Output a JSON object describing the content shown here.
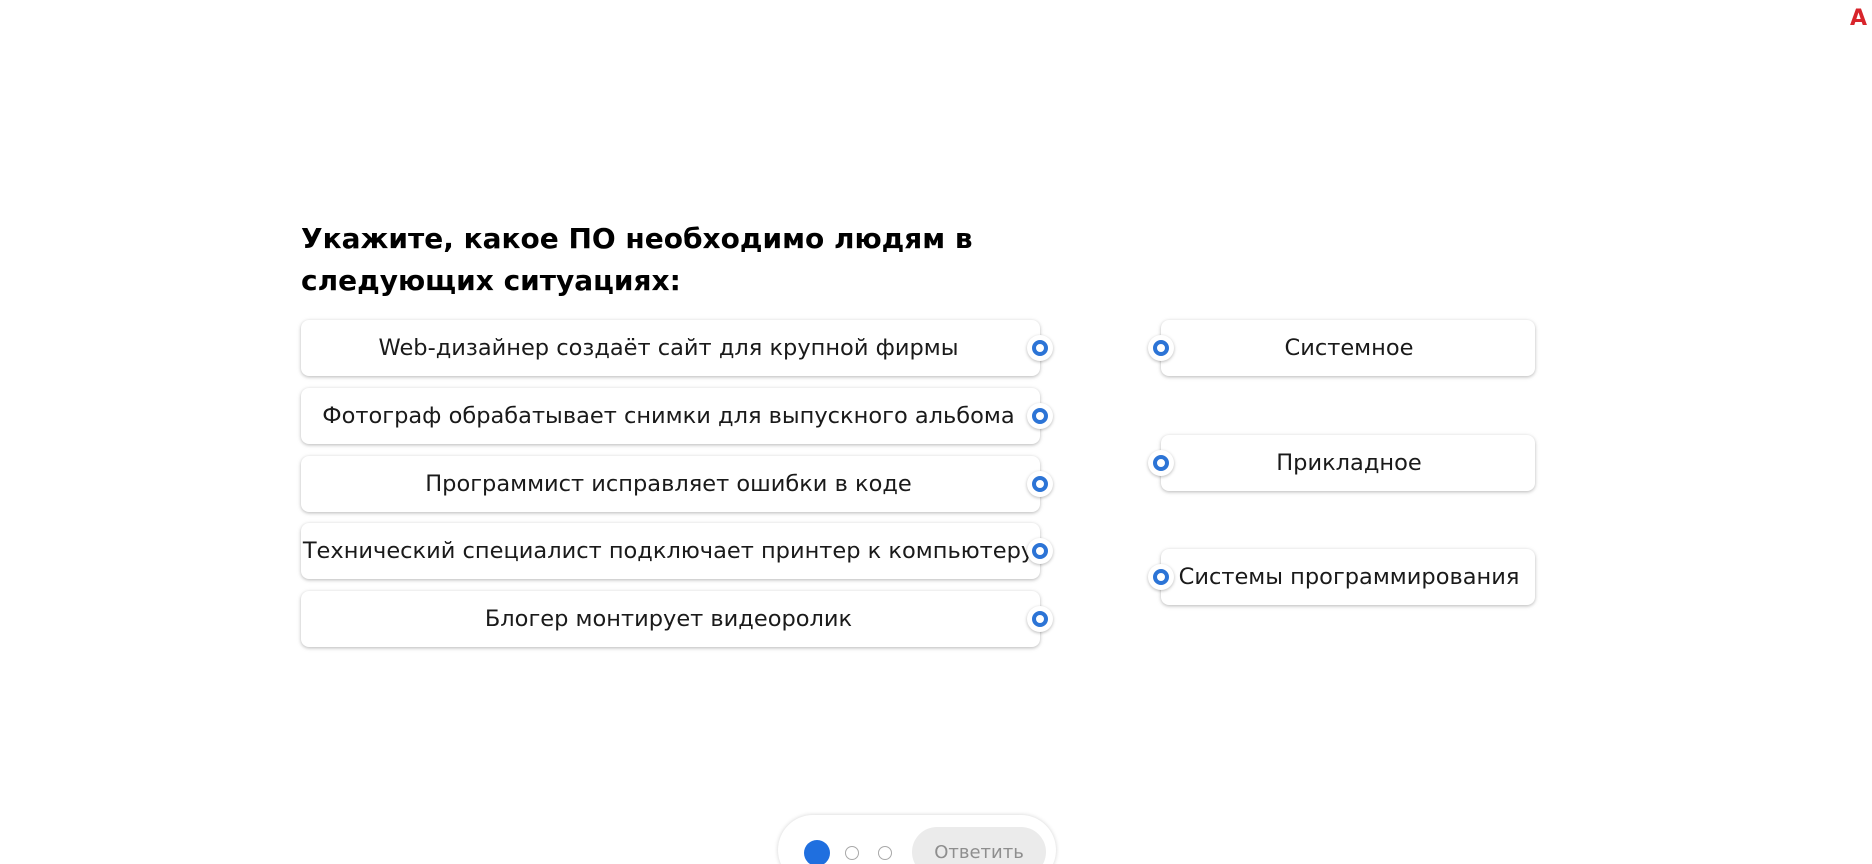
{
  "corner_text": "А",
  "question": {
    "title": "Укажите, какое ПО необходимо людям в следующих ситуациях:"
  },
  "situations": [
    {
      "label": "Web-дизайнер создаёт сайт для крупной фирмы"
    },
    {
      "label": "Фотограф обрабатывает снимки для выпускного альбома"
    },
    {
      "label": "Программист исправляет ошибки в коде"
    },
    {
      "label": "Технический специалист подключает принтер к компьютеру"
    },
    {
      "label": "Блогер монтирует видеоролик"
    }
  ],
  "software_types": [
    {
      "label": "Системное"
    },
    {
      "label": "Прикладное"
    },
    {
      "label": "Системы программирования"
    }
  ],
  "footer": {
    "steps": [
      {
        "state": "current"
      },
      {
        "state": "pending"
      },
      {
        "state": "pending"
      }
    ],
    "answer_label": "Ответить"
  },
  "colors": {
    "accent": "#2c74d6",
    "step_active": "#1f6fdf",
    "corner_text": "#d8242b",
    "button_disabled_bg": "#ebebeb",
    "button_disabled_text": "#8e8e8e"
  },
  "icons": {
    "connector": "ring-connector-icon"
  }
}
